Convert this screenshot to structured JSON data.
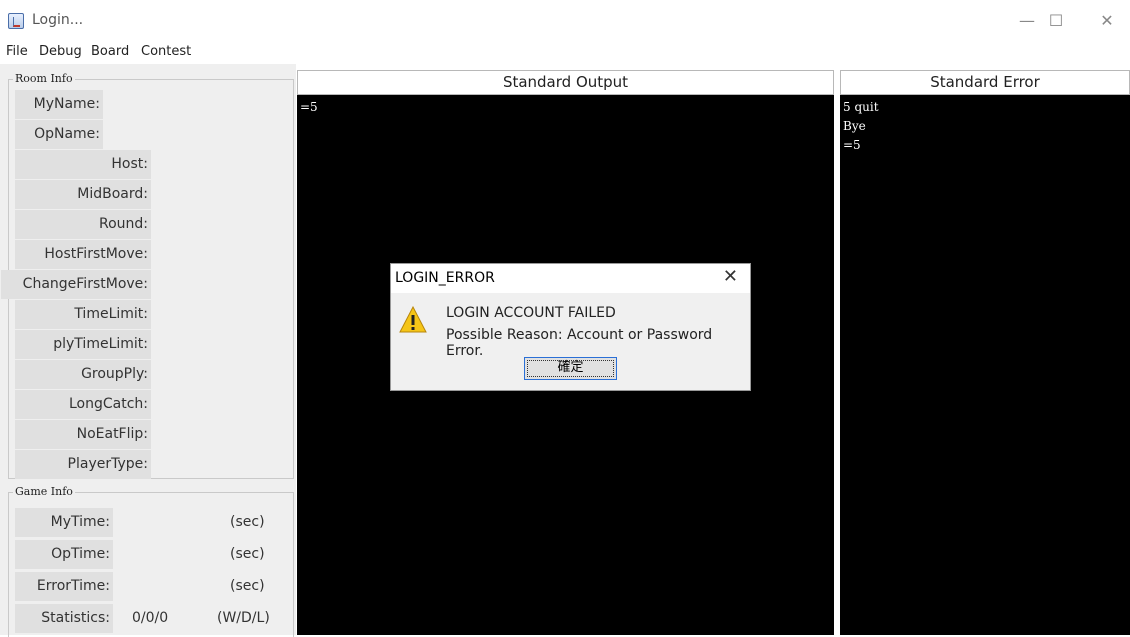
{
  "window": {
    "title": "Login...",
    "minimize": "—",
    "maximize": "☐",
    "close": "✕"
  },
  "menu": [
    "File",
    "Debug",
    "Board",
    "Contest"
  ],
  "room_info": {
    "title": "Room Info",
    "fields": [
      "MyName:",
      "OpName:",
      "Host:",
      "MidBoard:",
      "Round:",
      "HostFirstMove:",
      "ChangeFirstMove:",
      "TimeLimit:",
      "plyTimeLimit:",
      "GroupPly:",
      "LongCatch:",
      "NoEatFlip:",
      "PlayerType:"
    ]
  },
  "game_info": {
    "title": "Game Info",
    "mytime_label": "MyTime:",
    "mytime_unit": "(sec)",
    "optime_label": "OpTime:",
    "optime_unit": "(sec)",
    "errortime_label": "ErrorTime:",
    "errortime_unit": "(sec)",
    "statistics_label": "Statistics:",
    "statistics_value": "0/0/0",
    "statistics_unit": "(W/D/L)"
  },
  "stdout": {
    "title": "Standard Output",
    "text": "=5"
  },
  "stderr": {
    "title": "Standard Error",
    "text": "5 quit\nBye\n=5"
  },
  "dialog": {
    "title": "LOGIN_ERROR",
    "close": "✕",
    "message1": "LOGIN ACCOUNT FAILED",
    "message2": "Possible Reason: Account or Password Error.",
    "ok_label": "確定",
    "icon": "warning-icon"
  }
}
